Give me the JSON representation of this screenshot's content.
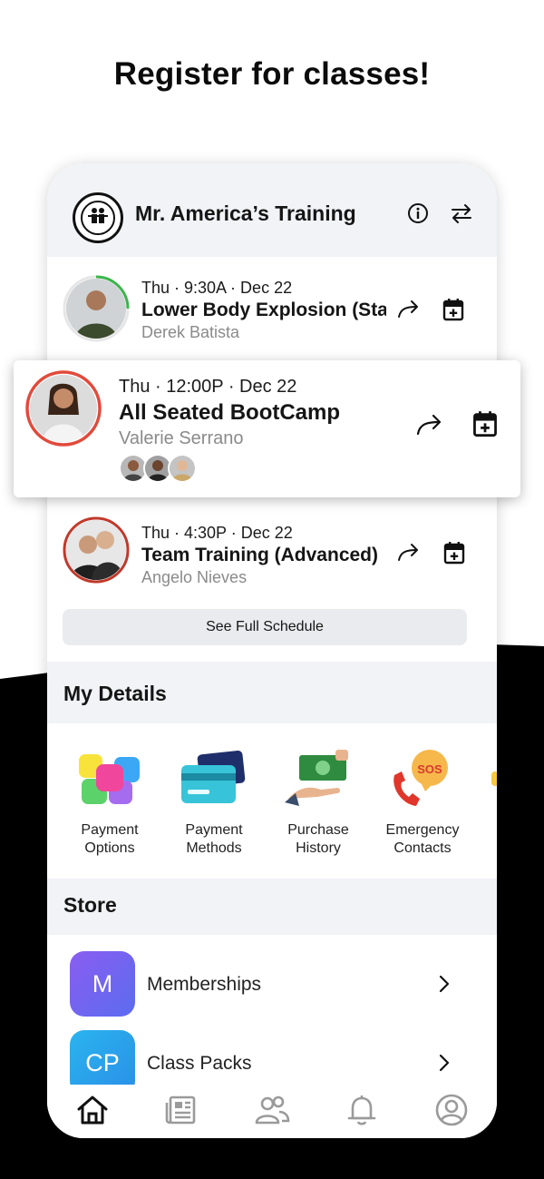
{
  "headline": "Register for classes!",
  "app": {
    "title": "Mr. America’s Training",
    "info_icon": "info-icon",
    "switch_icon": "swap-arrows-icon"
  },
  "classes": [
    {
      "date": "Thu · 9:30A · Dec 22",
      "title": "Lower Body Explosion (Static",
      "trainer": "Derek Batista",
      "ring_color": "#3ab54a"
    },
    {
      "date": "Thu · 12:00P · Dec 22",
      "title": "All Seated BootCamp",
      "trainer": "Valerie Serrano",
      "ring_color": "#e24a3b"
    },
    {
      "date": "Thu · 4:30P · Dec 22",
      "title": "Team Training (Advanced)",
      "trainer": "Angelo Nieves",
      "ring_color": "#c0392b"
    }
  ],
  "see_full_schedule": "See Full Schedule",
  "my_details": {
    "title": "My Details",
    "items": [
      {
        "line1": "Payment",
        "line2": "Options"
      },
      {
        "line1": "Payment",
        "line2": "Methods"
      },
      {
        "line1": "Purchase",
        "line2": "History"
      },
      {
        "line1": "Emergency",
        "line2": "Contacts"
      }
    ],
    "sos_text": "SOS"
  },
  "store": {
    "title": "Store",
    "items": [
      {
        "badge": "M",
        "label": "Memberships",
        "color": "#7a5cf0"
      },
      {
        "badge": "CP",
        "label": "Class Packs",
        "color": "#2aa8ec"
      }
    ]
  },
  "tabs": [
    "home-icon",
    "news-icon",
    "people-icon",
    "bell-icon",
    "profile-icon"
  ],
  "colors": {
    "header_bg": "#f1f3f6",
    "black_wave": "#000000"
  }
}
